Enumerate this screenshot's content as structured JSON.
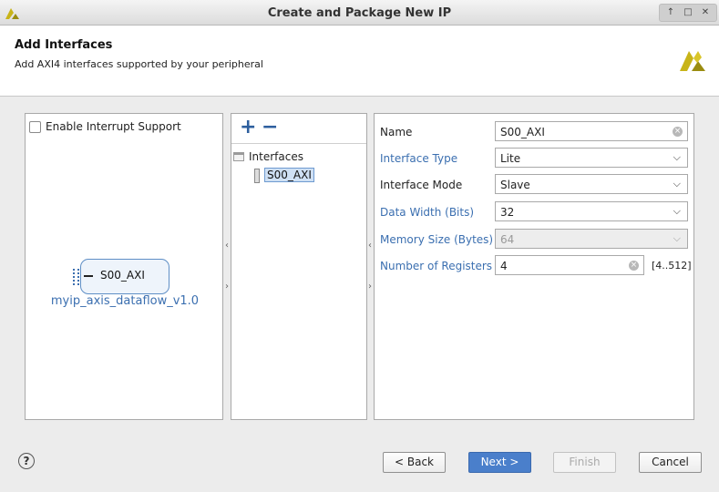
{
  "window": {
    "title": "Create and Package New IP",
    "controls": [
      "↑",
      "□",
      "✕"
    ]
  },
  "header": {
    "title": "Add Interfaces",
    "subtitle": "Add AXI4 interfaces supported by your peripheral"
  },
  "left_panel": {
    "interrupt_checkbox_label": "Enable Interrupt Support",
    "interrupt_checked": false,
    "port_label": "S00_AXI",
    "ip_name": "myip_axis_dataflow_v1.0"
  },
  "middle_panel": {
    "add_label": "+",
    "remove_label": "−",
    "tree_root": "Interfaces",
    "tree_child": "S00_AXI"
  },
  "right_panel": {
    "name_label": "Name",
    "name_value": "S00_AXI",
    "interface_type_label": "Interface Type",
    "interface_type_value": "Lite",
    "interface_mode_label": "Interface Mode",
    "interface_mode_value": "Slave",
    "data_width_label": "Data Width (Bits)",
    "data_width_value": "32",
    "memory_size_label": "Memory Size (Bytes)",
    "memory_size_value": "64",
    "num_registers_label": "Number of Registers",
    "num_registers_value": "4",
    "num_registers_range": "[4..512]"
  },
  "footer": {
    "help_label": "?",
    "back_label": "< Back",
    "next_label": "Next >",
    "finish_label": "Finish",
    "cancel_label": "Cancel"
  },
  "colors": {
    "accent_blue": "#4a7fcb",
    "link_blue": "#3b6fb0",
    "logo_yellow": "#c8b418"
  }
}
